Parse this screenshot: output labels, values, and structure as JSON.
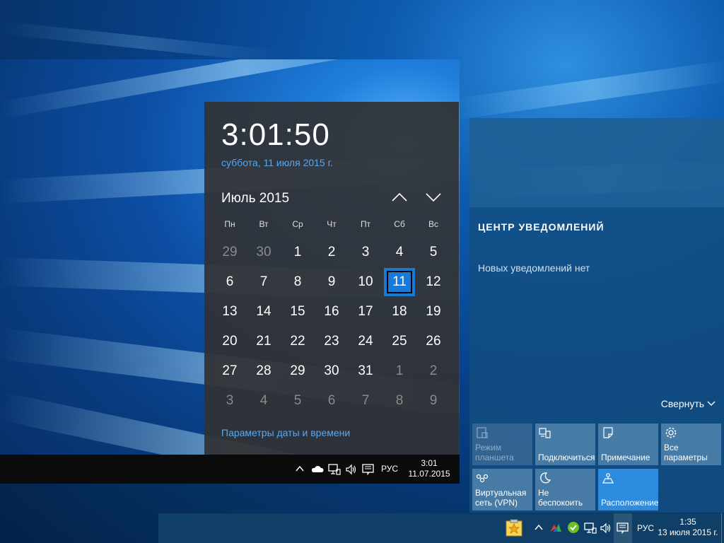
{
  "inner_taskbar": {
    "language": "РУС",
    "clock_time": "3:01",
    "clock_date": "11.07.2015",
    "tray_icons": [
      "chevron-up-icon",
      "onedrive-cloud-icon",
      "network-icon",
      "volume-icon",
      "notification-icon"
    ]
  },
  "calendar": {
    "time": "3:01:50",
    "date": "суббота, 11 июля 2015 г.",
    "month_label": "Июль 2015",
    "weekdays": [
      "Пн",
      "Вт",
      "Ср",
      "Чт",
      "Пт",
      "Сб",
      "Вс"
    ],
    "weeks": [
      [
        "29",
        "30",
        "1",
        "2",
        "3",
        "4",
        "5"
      ],
      [
        "6",
        "7",
        "8",
        "9",
        "10",
        "11",
        "12"
      ],
      [
        "13",
        "14",
        "15",
        "16",
        "17",
        "18",
        "19"
      ],
      [
        "20",
        "21",
        "22",
        "23",
        "24",
        "25",
        "26"
      ],
      [
        "27",
        "28",
        "29",
        "30",
        "31",
        "1",
        "2"
      ],
      [
        "3",
        "4",
        "5",
        "6",
        "7",
        "8",
        "9"
      ]
    ],
    "today": "11",
    "settings_link": "Параметры даты и времени"
  },
  "action_center": {
    "heading": "ЦЕНТР УВЕДОМЛЕНИЙ",
    "empty_text": "Новых уведомлений нет",
    "collapse_label": "Свернуть",
    "tiles": [
      {
        "label_1": "Режим",
        "label_2": "планшета",
        "icon": "tablet-mode-icon",
        "state": "disabled"
      },
      {
        "label_1": "Подключиться",
        "label_2": "",
        "icon": "connect-icon",
        "state": "normal"
      },
      {
        "label_1": "Примечание",
        "label_2": "",
        "icon": "note-icon",
        "state": "normal"
      },
      {
        "label_1": "Все",
        "label_2": "параметры",
        "icon": "settings-gear-icon",
        "state": "normal"
      },
      {
        "label_1": "Виртуальная",
        "label_2": "сеть (VPN)",
        "icon": "vpn-icon",
        "state": "normal"
      },
      {
        "label_1": "Не",
        "label_2": "беспокоить",
        "icon": "moon-icon",
        "state": "normal"
      },
      {
        "label_1": "Расположение",
        "label_2": "",
        "icon": "location-icon",
        "state": "active"
      }
    ]
  },
  "taskbar": {
    "language": "РУС",
    "clock_time": "1:35",
    "clock_date": "13 июля 2015 г.",
    "tray_icons": [
      "sticky-star-app-icon",
      "chevron-up-icon",
      "colored-arrows-app-icon",
      "green-shield-app-icon",
      "network-icon",
      "volume-icon",
      "notification-icon"
    ]
  },
  "colors": {
    "accent_blue": "#1979d6",
    "link_blue": "#59a8ef",
    "active_tile": "#2d8be0"
  }
}
